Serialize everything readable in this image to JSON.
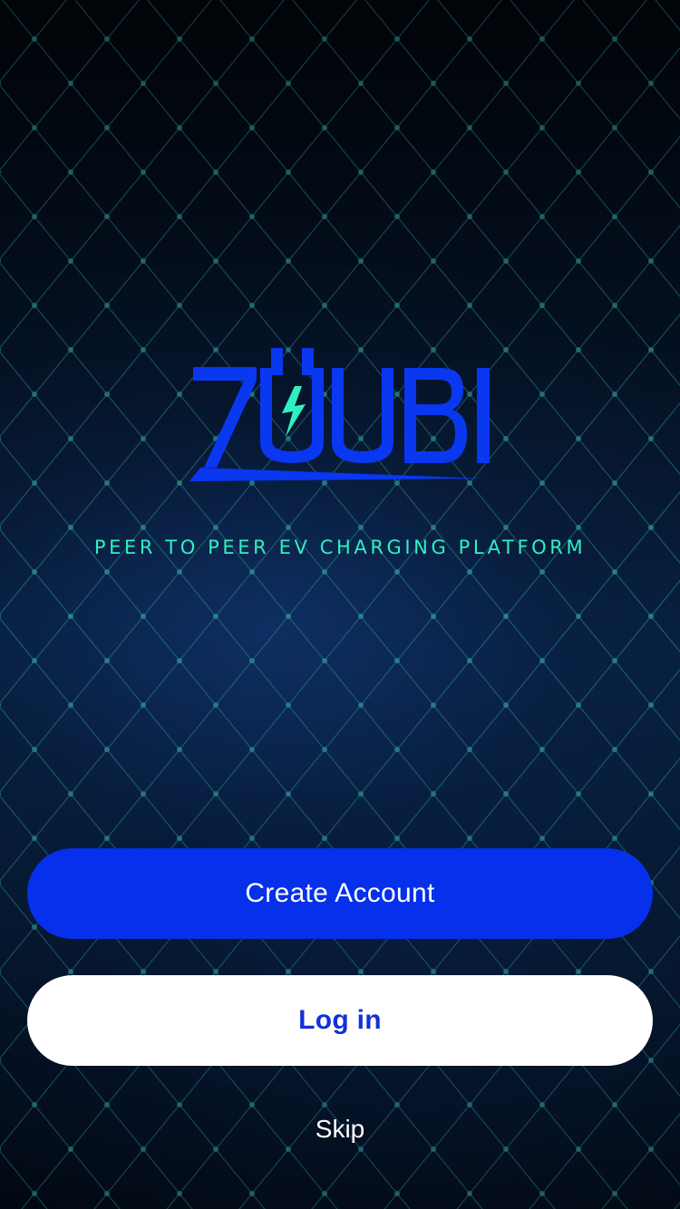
{
  "brand": {
    "name": "ZUUBI",
    "tagline": "PEER TO PEER EV CHARGING PLATFORM",
    "primary_color": "#0630ec",
    "accent_color": "#2ff0c0"
  },
  "actions": {
    "create_account_label": "Create Account",
    "login_label": "Log in",
    "skip_label": "Skip"
  },
  "icons": {
    "logo": "zuubi-plug-logo",
    "background": "grid-pattern"
  }
}
